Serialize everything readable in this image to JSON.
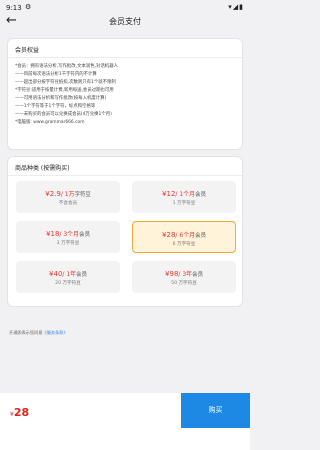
{
  "status": {
    "time": "9:13",
    "gear_icon": "⚙",
    "right_icons": "▾◢▮"
  },
  "header": {
    "back_icon": "←",
    "title": "会员支付"
  },
  "benefits": {
    "title": "会员权益",
    "lines": [
      "*会员：拥有语法分析,写作批改,文本润色,对话机器人",
      "——目前每次语法分析1千字符内的不计算",
      "——超出部分按字符豆抵扣,次数则只有1个就不限制",
      "*字符豆:适用于按量计费,新用每送,会员过期也可用",
      "——可用语法分析和写作批改(按每入机度计算)",
      "——1个字符等于1个字符，标点和空格等",
      "——未购买的会员可以兑换成会员(4万兑换1个月)",
      "*电脑版: www.grammar666.com"
    ]
  },
  "products": {
    "title": "商品种类 (按需购买)",
    "options": [
      {
        "price": "2.9",
        "unit": "/ 1万",
        "suffix": "字符豆",
        "desc": "不含会员",
        "selected": false
      },
      {
        "price": "12",
        "unit": "/ 1个月",
        "suffix": "会员",
        "desc": "1 万字符豆",
        "selected": false
      },
      {
        "price": "18",
        "unit": "/ 3个月",
        "suffix": "会员",
        "desc": "3 万字符豆",
        "selected": false
      },
      {
        "price": "28",
        "unit": "/ 6个月",
        "suffix": "会员",
        "desc": "6 万字符豆",
        "selected": true
      },
      {
        "price": "40",
        "unit": "/ 1年",
        "suffix": "会员",
        "desc": "20 万字符豆",
        "selected": false
      },
      {
        "price": "98",
        "unit": "/ 3年",
        "suffix": "会员",
        "desc": "50 万字符豆",
        "selected": false
      }
    ]
  },
  "agreement": {
    "text": "开通即表示您同意",
    "link": "《服务条款》"
  },
  "footer": {
    "currency": "¥",
    "amount": "28",
    "buy_label": "购买"
  },
  "colors": {
    "accent": "#1e88e5",
    "price": "#e7352c",
    "selected_border": "#f3a83a",
    "selected_bg": "#fff3d9"
  }
}
